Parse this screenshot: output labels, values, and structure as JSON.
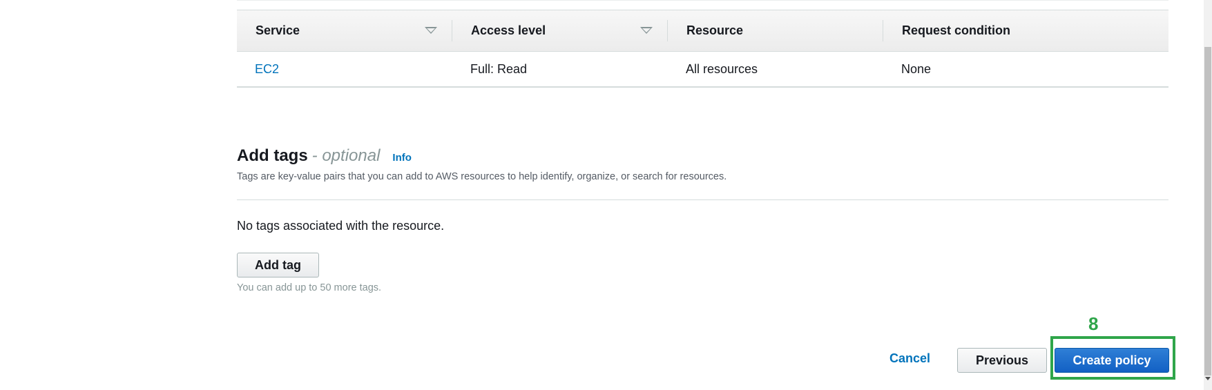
{
  "table": {
    "headers": [
      {
        "label": "Service",
        "sortable": true
      },
      {
        "label": "Access level",
        "sortable": true
      },
      {
        "label": "Resource",
        "sortable": false
      },
      {
        "label": "Request condition",
        "sortable": false
      }
    ],
    "rows": [
      {
        "service": "EC2",
        "access_level": "Full: Read",
        "resource": "All resources",
        "request_condition": "None"
      }
    ]
  },
  "tags": {
    "title": "Add tags",
    "optional": "- optional",
    "info_link": "Info",
    "description": "Tags are key-value pairs that you can add to AWS resources to help identify, organize, or search for resources.",
    "empty_message": "No tags associated with the resource.",
    "add_button": "Add tag",
    "limit_text": "You can add up to 50 more tags."
  },
  "footer": {
    "cancel_label": "Cancel",
    "previous_label": "Previous",
    "create_label": "Create policy"
  },
  "annotation": {
    "step_number": "8",
    "color": "#2fa54a"
  },
  "colors": {
    "link": "#0073bb",
    "primary_button": "#1a6fd0",
    "header_bg": "#f2f2f2"
  }
}
